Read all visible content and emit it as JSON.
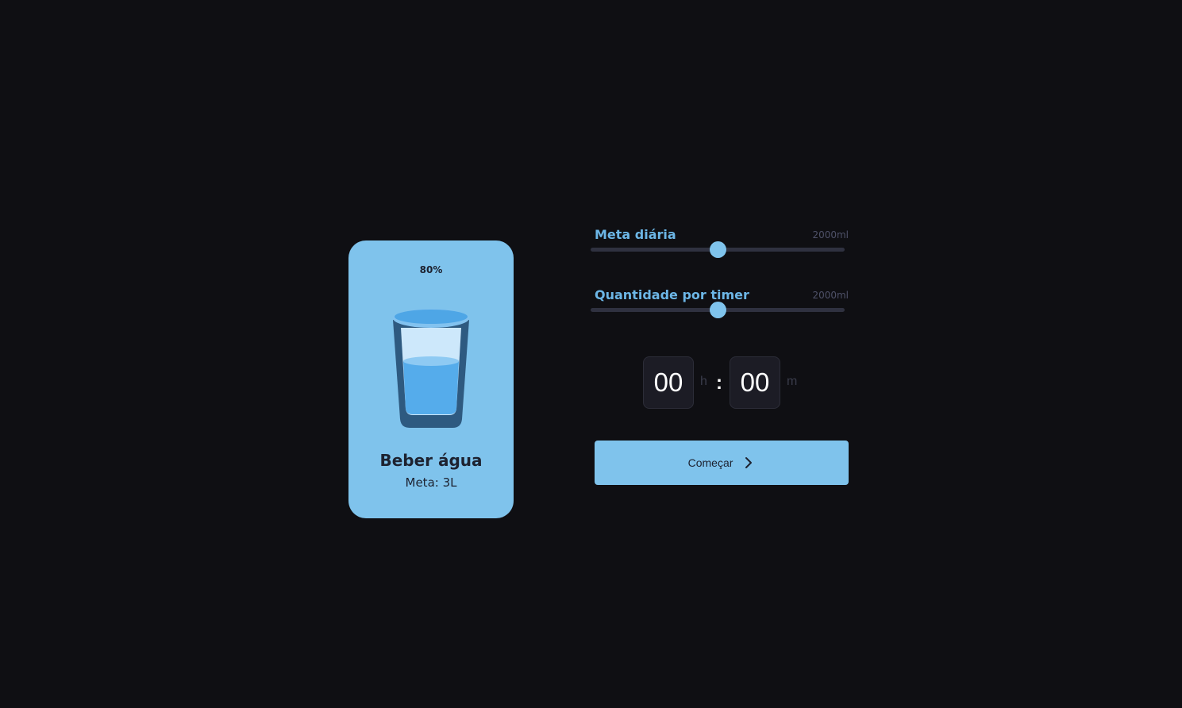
{
  "card": {
    "percent": "80%",
    "progress": 0.8,
    "title": "Beber água",
    "subtitle": "Meta: 3L",
    "icon": "water-glass-icon"
  },
  "sliders": [
    {
      "label": "Meta diária",
      "value_text": "2000ml",
      "position": 0.5
    },
    {
      "label": "Quantidade por timer",
      "value_text": "2000ml",
      "position": 0.5
    }
  ],
  "timer": {
    "hours": "00",
    "hours_unit": "h",
    "separator": ":",
    "minutes": "00",
    "minutes_unit": "m"
  },
  "start_button": {
    "label": "Começar",
    "icon": "chevron-right-icon"
  },
  "colors": {
    "background": "#0f0f13",
    "accent": "#7fc3ec",
    "track": "#2f3140",
    "text_dark": "#1d2230"
  }
}
